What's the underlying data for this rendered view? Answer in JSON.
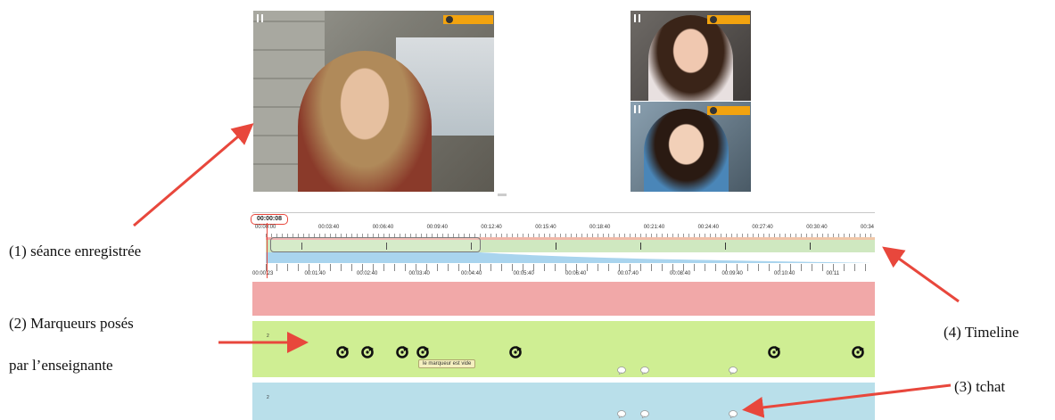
{
  "captions": {
    "recorded_session": "(1) séance enregistrée",
    "markers_line1": "(2) Marqueurs posés",
    "markers_line2": "par l’enseignante",
    "timeline": "(4) Timeline",
    "chat": "(3) tchat"
  },
  "timeline": {
    "current_time": "00:00:08",
    "top_start_label": "00:00:00",
    "top_ticks": [
      "00:03:40",
      "00:06:40",
      "00:09:40",
      "00:12:40",
      "00:15:40",
      "00:18:40",
      "00:21:40",
      "00:24:40",
      "00:27:40",
      "00:30:40",
      "00:34"
    ],
    "bottom_ticks": [
      "00:00:23",
      "00:01:40",
      "00:02:40",
      "00:03:40",
      "00:04:40",
      "00:05:40",
      "00:06:40",
      "00:07:40",
      "00:08:40",
      "00:09:40",
      "00:10:40",
      "00:11"
    ]
  },
  "tracks": {
    "marker_track_number": "2",
    "chat_track_number": "2",
    "tooltip": "le marqueur est vide"
  },
  "colors": {
    "accent_orange": "#f2a30f",
    "annotation_red": "#e8473c",
    "track_pink": "#f1a8a8",
    "track_green": "#cfee93",
    "track_blue": "#b9dfea",
    "selection_blue": "#a9d4ee"
  },
  "icons": {
    "video_pause": "pause-icon",
    "participant": "user-icon",
    "marker": "marker-icon",
    "chat_bubble": "chat-bubble-icon"
  }
}
